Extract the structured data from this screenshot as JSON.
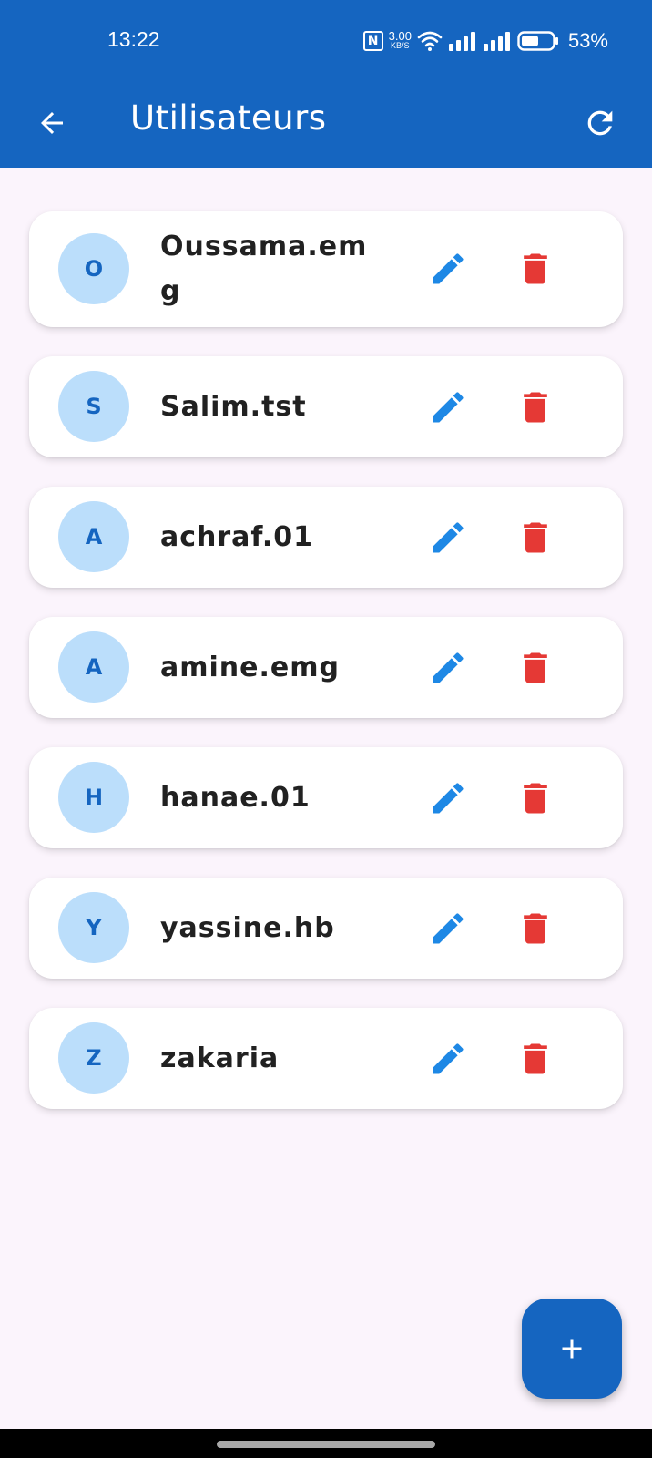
{
  "status_bar": {
    "time": "13:22",
    "net_speed_value": "3.00",
    "net_speed_unit": "KB/S",
    "battery": "53%"
  },
  "app_bar": {
    "title": "Utilisateurs"
  },
  "colors": {
    "primary": "#1565c0",
    "avatar_bg": "#bbdefb",
    "edit": "#1e88e5",
    "delete": "#e53935",
    "background": "#fbf4fc"
  },
  "users": [
    {
      "initial": "O",
      "username": "Oussama.emg"
    },
    {
      "initial": "S",
      "username": "Salim.tst"
    },
    {
      "initial": "A",
      "username": "achraf.01"
    },
    {
      "initial": "A",
      "username": "amine.emg"
    },
    {
      "initial": "H",
      "username": "hanae.01"
    },
    {
      "initial": "Y",
      "username": "yassine.hb"
    },
    {
      "initial": "Z",
      "username": "zakaria"
    }
  ],
  "icons": {
    "back": "arrow-back-icon",
    "refresh": "refresh-icon",
    "edit": "pencil-icon",
    "delete": "trash-icon",
    "fab": "plus-icon"
  }
}
